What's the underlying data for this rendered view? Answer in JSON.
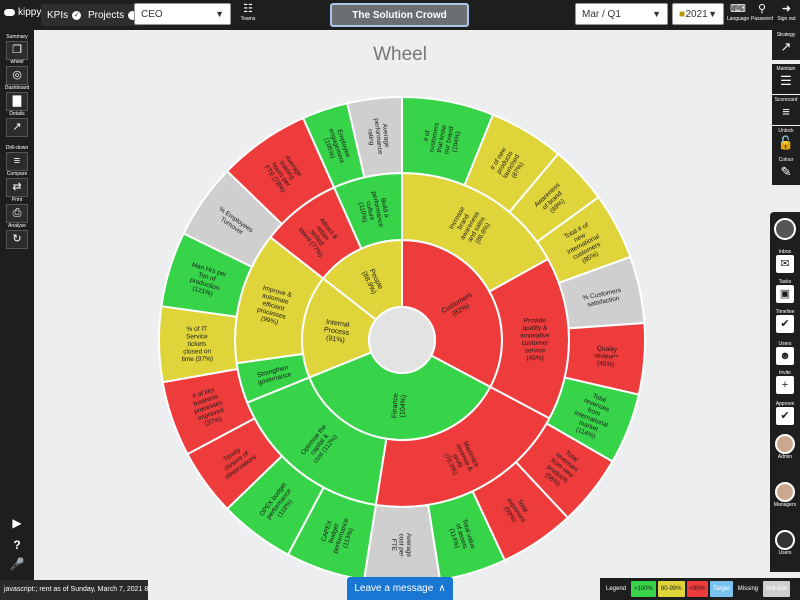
{
  "topbar": {
    "logo": "kippy",
    "kpis_label": "KPIs",
    "projects_label": "Projects",
    "check": "✓",
    "role_select": "CEO",
    "teams_label": "Teams",
    "title": "The Solution Crowd",
    "period_select": "Mar / Q1",
    "year_select": "2021",
    "language_label": "Language",
    "password_label": "Password",
    "signout_label": "Sign out"
  },
  "left_nav": [
    {
      "label": "Summary",
      "icon": "copy-icon",
      "glyph": "❐"
    },
    {
      "label": "wheel",
      "icon": "wheel-icon",
      "glyph": "◎"
    },
    {
      "label": "Dashboard",
      "icon": "dashboard-icon",
      "glyph": "▇"
    },
    {
      "label": "Details",
      "icon": "details-chart-icon",
      "glyph": "↗"
    },
    {
      "label": "Drill-down",
      "icon": "drilldown-icon",
      "glyph": "≡"
    },
    {
      "label": "Compare",
      "icon": "compare-icon",
      "glyph": "⇄"
    },
    {
      "label": "Print",
      "icon": "print-icon",
      "glyph": "⎙"
    },
    {
      "label": "Analyse",
      "icon": "analyse-icon",
      "glyph": "↻"
    }
  ],
  "left_bottom": {
    "play": "▶",
    "help": "?",
    "mic": "🎤"
  },
  "right_top": [
    {
      "label": "Strategy",
      "icon": "strategy-icon",
      "glyph": "↗"
    },
    {
      "label": "Maintain",
      "icon": "maintain-icon",
      "glyph": "☰"
    },
    {
      "label": "Scorecard",
      "icon": "scorecard-icon",
      "glyph": "≡"
    },
    {
      "label": "Unlock",
      "icon": "unlock-icon",
      "glyph": "🔓"
    },
    {
      "label": "Colour",
      "icon": "colour-icon",
      "glyph": "✎"
    }
  ],
  "right_panel": [
    {
      "label": "Inbox",
      "icon": "inbox-icon",
      "glyph": "✉"
    },
    {
      "label": "Tasks",
      "icon": "tasks-icon",
      "glyph": "▣"
    },
    {
      "label": "Timeline",
      "icon": "timeline-icon",
      "glyph": "✔"
    },
    {
      "label": "Users",
      "icon": "users-icon",
      "glyph": "☻"
    },
    {
      "label": "Invite",
      "icon": "invite-icon",
      "glyph": "+"
    },
    {
      "label": "Approve",
      "icon": "approve-icon",
      "glyph": "✔"
    },
    {
      "label": "Admin",
      "icon": "admin-avatar",
      "glyph": ""
    },
    {
      "label": "Managers",
      "icon": "managers-avatar",
      "glyph": ""
    },
    {
      "label": "Users",
      "icon": "user-profile-icon",
      "glyph": ""
    }
  ],
  "page_title": "Wheel",
  "status_text": "javascript:;  rent as of Sunday, March 7, 2021 8:00 PM",
  "leave_message": "Leave a message",
  "leave_message_caret": "∧",
  "legend": {
    "title": "Legend",
    "chips": [
      {
        "label": ">100%",
        "color": "#37d44a",
        "text_color": "#1e1e1e"
      },
      {
        "label": "80-99%",
        "color": "#dfd43a",
        "text_color": "#1e1e1e"
      },
      {
        "label": "<80%",
        "color": "#ee3b3b",
        "text_color": "#1e1e1e"
      },
      {
        "label": "Target",
        "color": "#79c3f0",
        "text_color": "#ffffff"
      },
      {
        "label": "Missing",
        "color": "#1e1e1e",
        "text_color": "#ffffff"
      },
      {
        "label": "Not due",
        "color": "#cfcfcf",
        "text_color": "#ffffff"
      }
    ]
  },
  "colors": {
    "green": "#37d44a",
    "yellow": "#dfd43a",
    "red": "#ee3b3b",
    "gray": "#cfcfcf"
  },
  "chart_data": {
    "type": "sunburst",
    "title": "Wheel",
    "inner_ring": [
      {
        "label": "Customers (82%)",
        "status": "red"
      },
      {
        "label": "Finance (104%)",
        "status": "green"
      },
      {
        "label": "Internal Process (91%)",
        "status": "yellow"
      },
      {
        "label": "People (88.9%)",
        "status": "yellow"
      }
    ],
    "middle_ring": [
      {
        "label": "Increase brand awareness and sales (86.8%)",
        "status": "yellow"
      },
      {
        "label": "Provide quality & innovative customer service (45%)",
        "status": "red"
      },
      {
        "label": "Maximize revenue & profit (76.9%)",
        "status": "red"
      },
      {
        "label": "Optimise the capital & cost (112%)",
        "status": "green"
      },
      {
        "label": "Strengthen governance",
        "status": "green"
      },
      {
        "label": "Improve & automate efficient processes (99%)",
        "status": "yellow"
      },
      {
        "label": "Attract & retain skilled talent (77%)",
        "status": "red"
      },
      {
        "label": "Build a performance culture (110%)",
        "status": "green"
      }
    ],
    "outer_ring": [
      {
        "label": "# of customers that know our brand (104%)",
        "status": "green"
      },
      {
        "label": "# of new products launched (87%)",
        "status": "yellow"
      },
      {
        "label": "Awareness of brand (89%)",
        "status": "yellow"
      },
      {
        "label": "Total # of new international customers (85%)",
        "status": "yellow"
      },
      {
        "label": "% Customers satisfaction",
        "status": "gray"
      },
      {
        "label": "Quality review** (45%)",
        "status": "red"
      },
      {
        "label": "Total revenues from international market (114%)",
        "status": "green"
      },
      {
        "label": "Total revenues from new products (56%)",
        "status": "red"
      },
      {
        "label": "Total expenses (59%)",
        "status": "red"
      },
      {
        "label": "Total value of assets (114%)",
        "status": "green"
      },
      {
        "label": "Average cost per FTE",
        "status": "gray"
      },
      {
        "label": "CAPEX budget performance (113%)",
        "status": "green"
      },
      {
        "label": "OPEX budget performance (118%)",
        "status": "green"
      },
      {
        "label": "Timely closure of observations",
        "status": "red"
      },
      {
        "label": "# of key business processes improved (37%)",
        "status": "red"
      },
      {
        "label": "% of IT Service tickets closed on time (97%)",
        "status": "yellow"
      },
      {
        "label": "Man Hrs per Ton of production (121%)",
        "status": "green"
      },
      {
        "label": "% Employees Turnover",
        "status": "gray"
      },
      {
        "label": "Average training hours per FTE (78%)",
        "status": "red"
      },
      {
        "label": "Employee engagement (105%)",
        "status": "green"
      },
      {
        "label": "Average performance rating",
        "status": "gray"
      }
    ]
  }
}
